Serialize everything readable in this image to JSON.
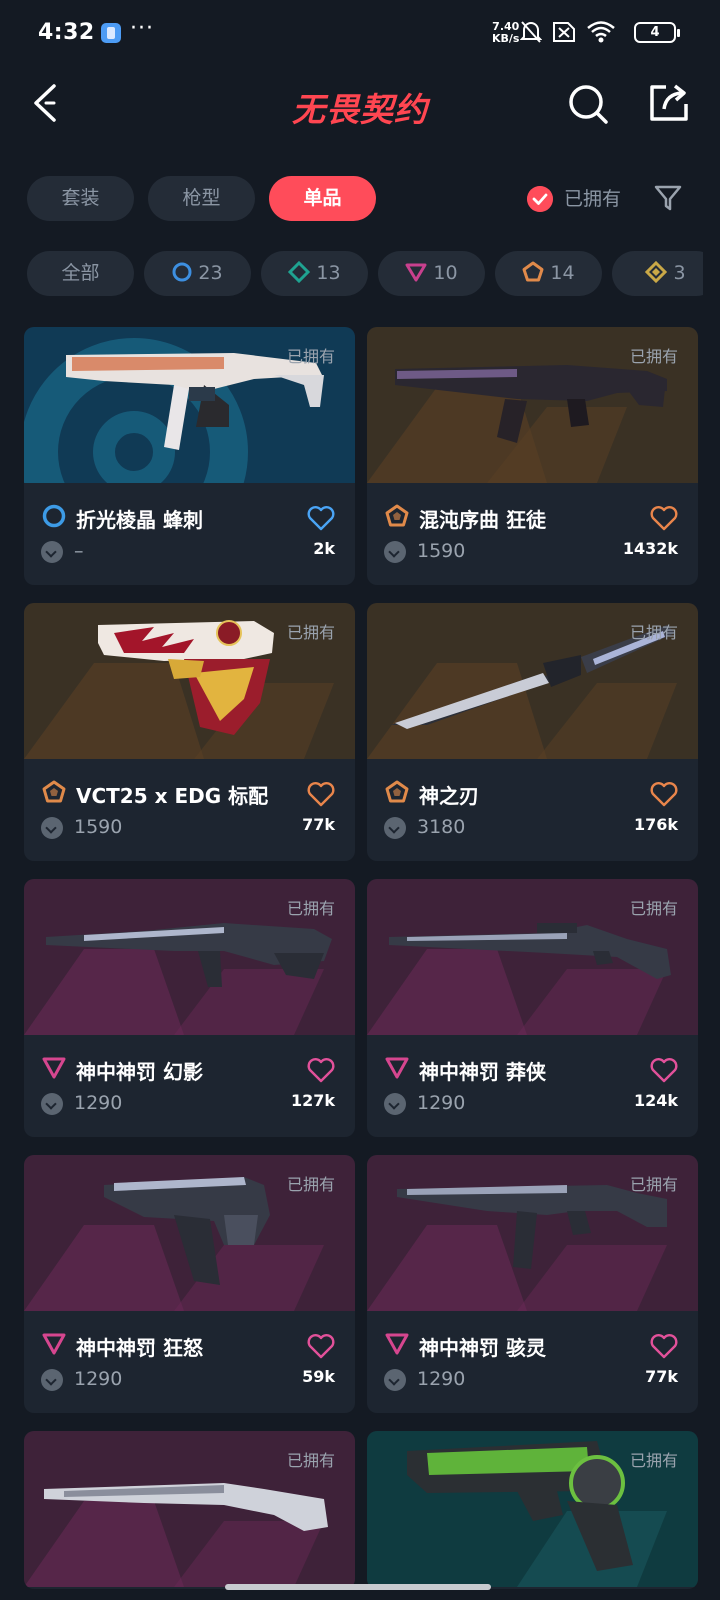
{
  "status_bar": {
    "time": "4:32",
    "speed_top": "7.40",
    "speed_bottom": "KB/s",
    "battery": "4",
    "icons": [
      "app-badge-icon",
      "more-dots-icon",
      "mute-bell-icon",
      "sim-off-icon",
      "wifi-icon",
      "battery-icon"
    ]
  },
  "header": {
    "title": "无畏契约",
    "back_icon": "chevron-left-icon",
    "search_icon": "search-icon",
    "share_icon": "share-icon"
  },
  "tabs": [
    {
      "label": "套装",
      "active": false
    },
    {
      "label": "枪型",
      "active": false
    },
    {
      "label": "单品",
      "active": true
    }
  ],
  "owned_filter": {
    "label": "已拥有",
    "checked": true
  },
  "filter_icon": "filter-funnel-icon",
  "chips": [
    {
      "label": "全部",
      "icon": ""
    },
    {
      "label": "23",
      "icon": "select-tier-icon",
      "color": "#3d8fe0"
    },
    {
      "label": "13",
      "icon": "deluxe-tier-icon",
      "color": "#1fa391"
    },
    {
      "label": "10",
      "icon": "premium-tier-icon",
      "color": "#c9408e"
    },
    {
      "label": "14",
      "icon": "exclusive-tier-icon",
      "color": "#e08a4a"
    },
    {
      "label": "3",
      "icon": "ultra-tier-icon",
      "color": "#c9a847"
    }
  ],
  "cards": [
    {
      "name": "折光棱晶 蜂刺",
      "price": "–",
      "likes": "2k",
      "owned": "已拥有",
      "tier": "select",
      "heart_color": "#4aa4f5",
      "tier_color": "#3d9be6"
    },
    {
      "name": "混沌序曲 狂徒",
      "price": "1590",
      "likes": "1432k",
      "owned": "已拥有",
      "tier": "exclusive",
      "heart_color": "#e9854b",
      "tier_color": "#e08a4a"
    },
    {
      "name": "VCT25 x EDG 标配",
      "price": "1590",
      "likes": "77k",
      "owned": "已拥有",
      "tier": "exclusive",
      "heart_color": "#e9854b",
      "tier_color": "#e08a4a"
    },
    {
      "name": "神之刃",
      "price": "3180",
      "likes": "176k",
      "owned": "已拥有",
      "tier": "exclusive",
      "heart_color": "#e9854b",
      "tier_color": "#e08a4a"
    },
    {
      "name": "神中神罚 幻影",
      "price": "1290",
      "likes": "127k",
      "owned": "已拥有",
      "tier": "premium",
      "heart_color": "#e2519a",
      "tier_color": "#d6468f"
    },
    {
      "name": "神中神罚 莽侠",
      "price": "1290",
      "likes": "124k",
      "owned": "已拥有",
      "tier": "premium",
      "heart_color": "#e2519a",
      "tier_color": "#d6468f"
    },
    {
      "name": "神中神罚 狂怒",
      "price": "1290",
      "likes": "59k",
      "owned": "已拥有",
      "tier": "premium",
      "heart_color": "#e2519a",
      "tier_color": "#d6468f"
    },
    {
      "name": "神中神罚 骇灵",
      "price": "1290",
      "likes": "77k",
      "owned": "已拥有",
      "tier": "premium",
      "heart_color": "#e2519a",
      "tier_color": "#d6468f"
    },
    {
      "name": "",
      "price": "",
      "likes": "",
      "owned": "已拥有",
      "tier": "premium"
    },
    {
      "name": "",
      "price": "",
      "likes": "",
      "owned": "已拥有",
      "tier": "deluxe"
    }
  ]
}
